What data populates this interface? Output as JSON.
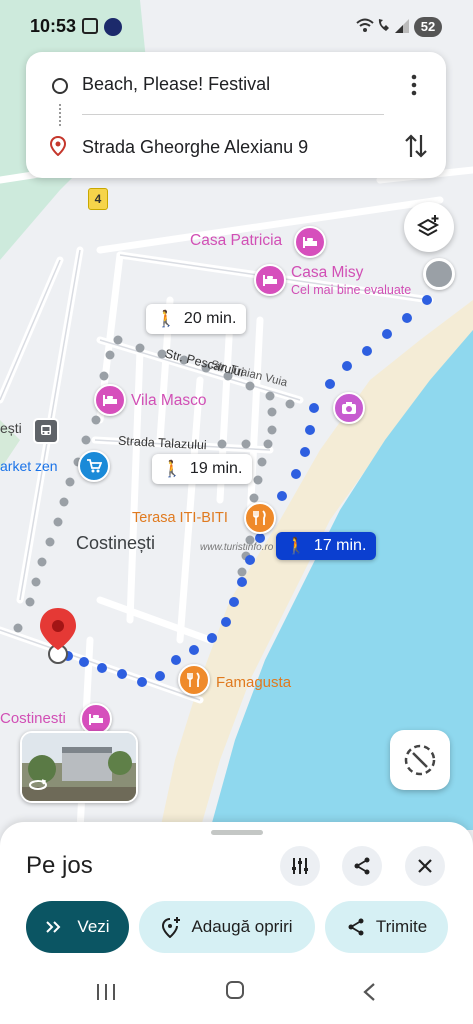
{
  "status": {
    "time": "10:53",
    "battery": "52"
  },
  "route": {
    "origin": "Beach, Please! Festival",
    "destination": "Strada Gheorghe Alexianu 9"
  },
  "map": {
    "road_badge": "4",
    "places": {
      "casa_patricia": "Casa Patricia",
      "casa_misy": "Casa Misy",
      "casa_misy_sub": "Cel mai bine evaluate",
      "vila_masco": "Vila Masco",
      "terasa": "Terasa ITI-BITI",
      "famagusta": "Famagusta",
      "costinesti_bottom": "Costinesti",
      "market": "arket zen",
      "esti": "ești"
    },
    "streets": {
      "traian": "Str. Traian Vuia",
      "pescarului": "Str. Pescarului",
      "talazului": "Strada Talazului"
    },
    "town": "Costinești",
    "watermark": "www.turistinfo.ro",
    "times": {
      "t1": "20 min.",
      "t2": "19 min.",
      "t3": "17 min."
    }
  },
  "sheet": {
    "title": "Pe jos",
    "btn_view": "Vezi",
    "btn_add": "Adaugă opriri",
    "btn_send": "Trimite"
  },
  "colors": {
    "accent": "#0b5563",
    "route_blue": "#2e5fe0",
    "water": "#8fd8ee",
    "land": "#eef0f3"
  }
}
